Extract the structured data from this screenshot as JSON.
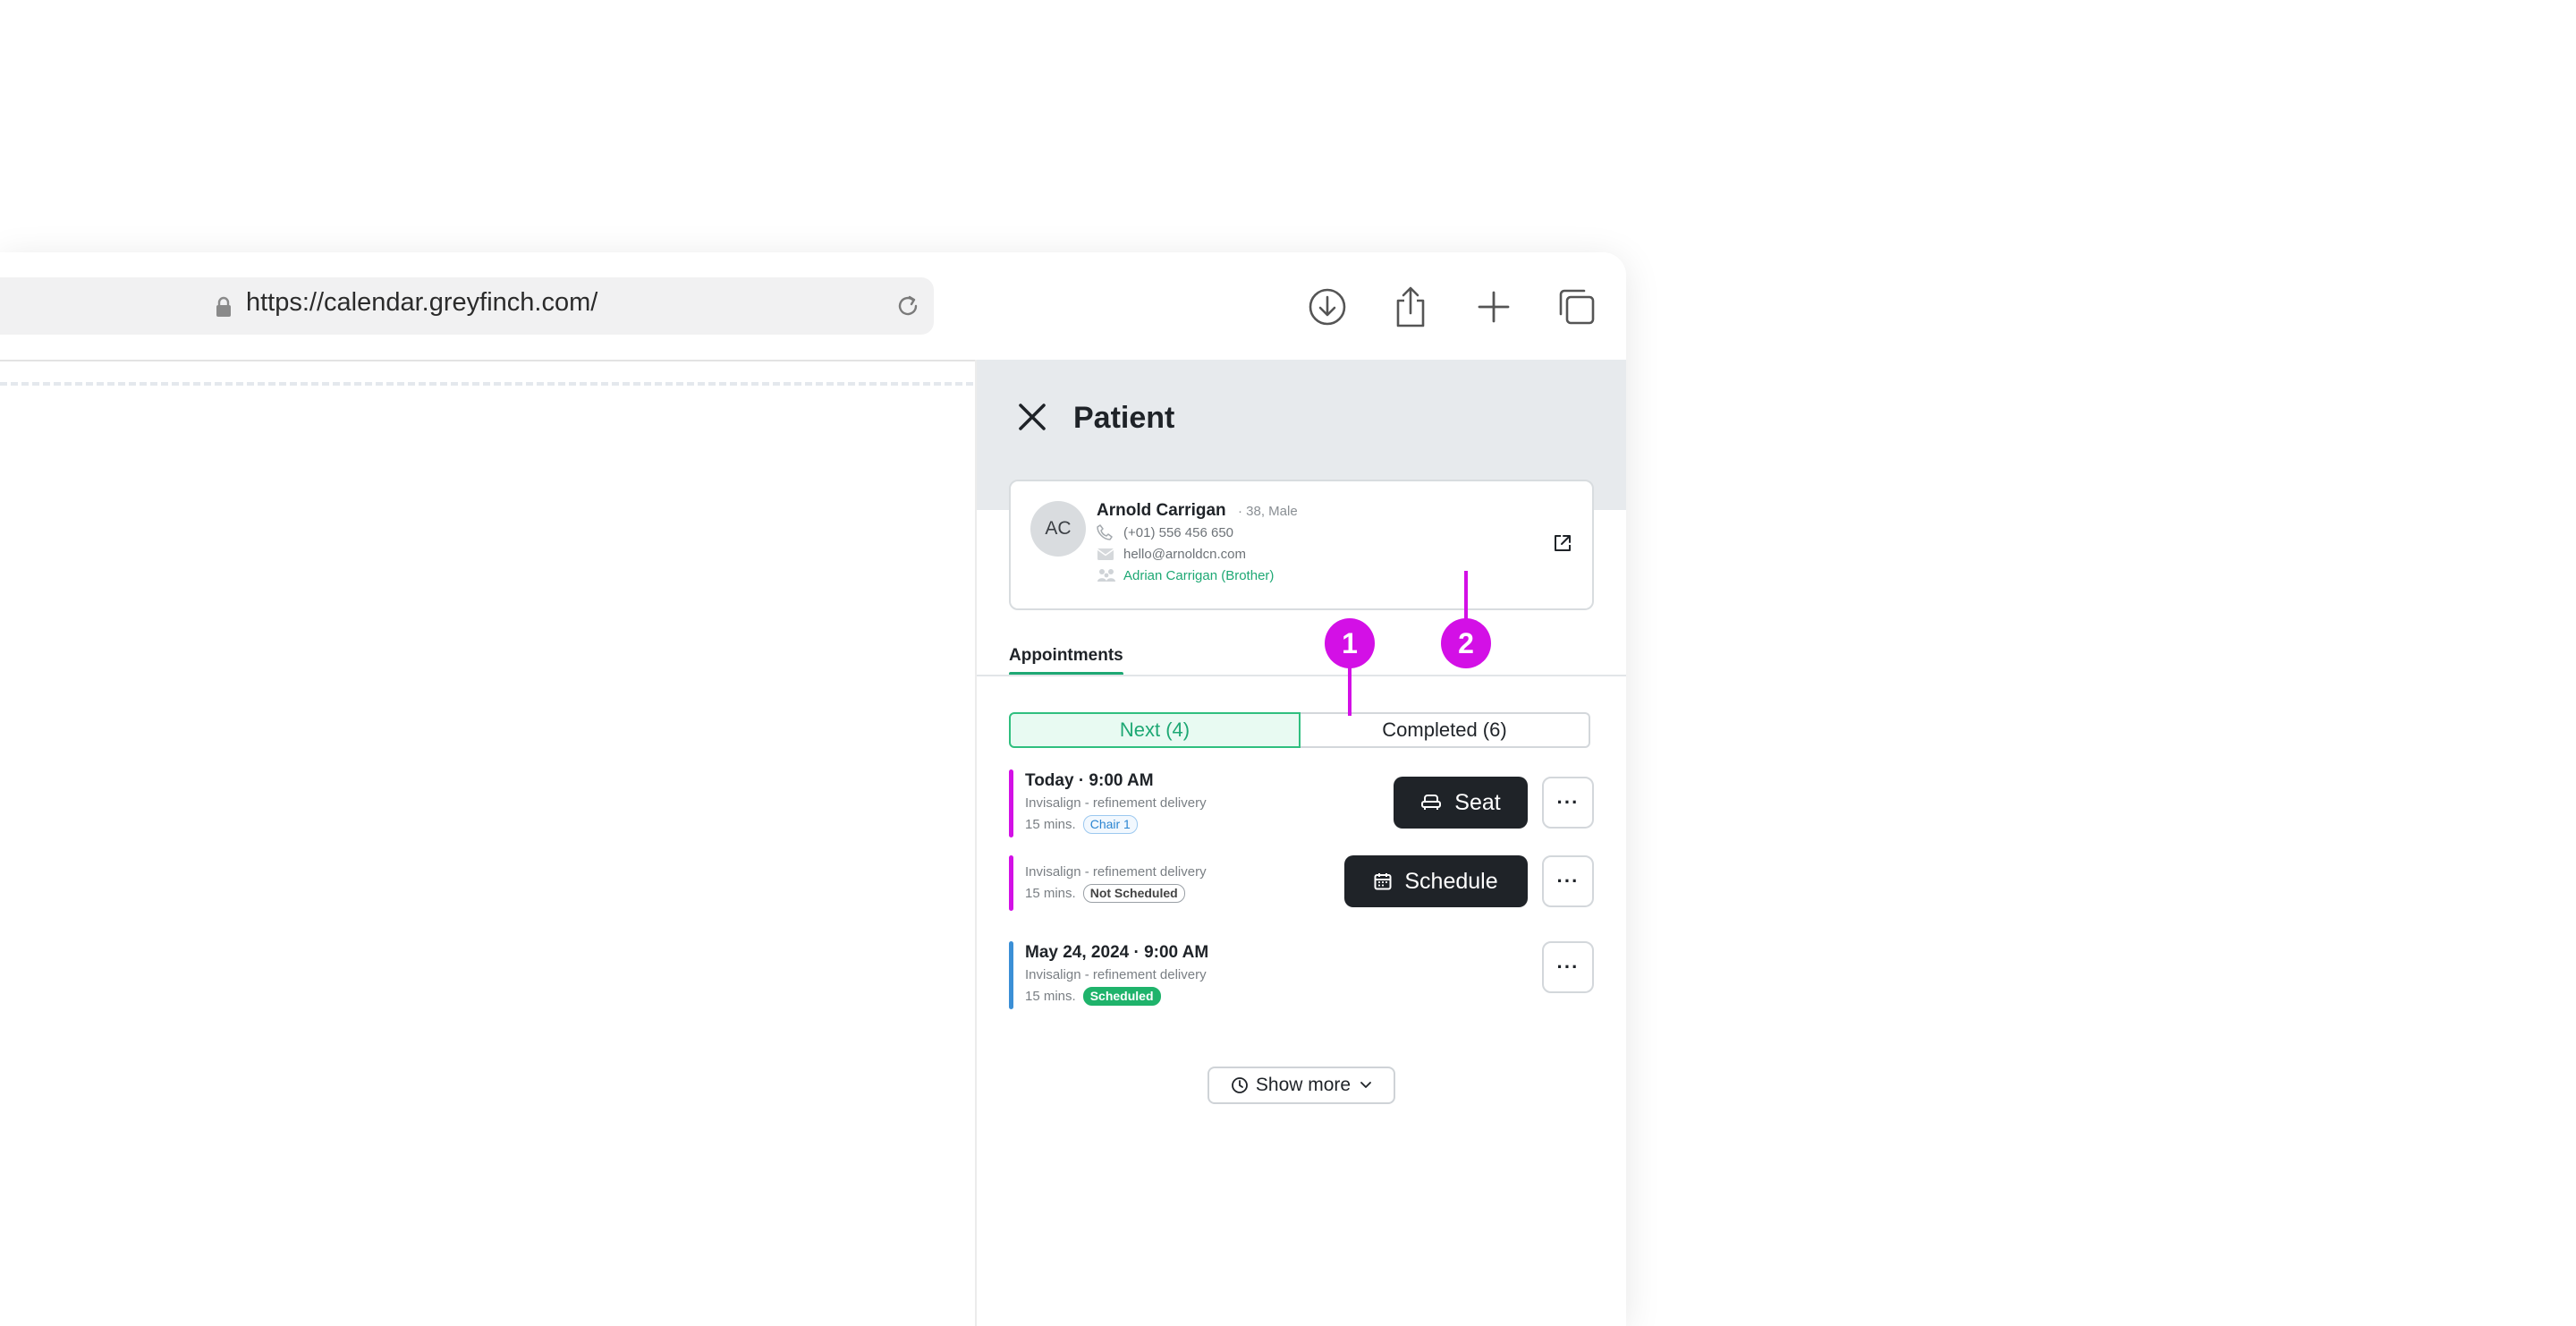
{
  "browser": {
    "url": "https://calendar.greyfinch.com/"
  },
  "panel": {
    "title": "Patient",
    "patient": {
      "initials": "AC",
      "name": "Arnold Carrigan",
      "meta": "· 38, Male",
      "phone": "(+01) 556 456 650",
      "email": "hello@arnoldcn.com",
      "relation": "Adrian Carrigan (Brother)"
    },
    "tabs": [
      {
        "label": "Appointments"
      }
    ],
    "segments": [
      {
        "label": "Next (4)"
      },
      {
        "label": "Completed (6)"
      }
    ],
    "appointments": [
      {
        "date": "Today · 9:00 AM",
        "description": "Invisalign - refinement delivery",
        "duration": "15 mins.",
        "badge": "Chair 1",
        "action": "Seat",
        "bar_color": "#d310e6"
      },
      {
        "date": "",
        "description": "Invisalign - refinement delivery",
        "duration": "15 mins.",
        "badge": "Not Scheduled",
        "action": "Schedule",
        "bar_color": "#d310e6"
      },
      {
        "date": "May 24, 2024 · 9:00 AM",
        "description": "Invisalign - refinement delivery",
        "duration": "15 mins.",
        "badge": "Scheduled",
        "action": "",
        "bar_color": "#3b8fd6"
      }
    ],
    "more_label": "···",
    "show_more": "Show more"
  },
  "annotations": [
    {
      "label": "1"
    },
    {
      "label": "2"
    }
  ],
  "colors": {
    "accent_green": "#1ea874",
    "annotation": "#d310e6",
    "dark_button": "#1f2328"
  }
}
